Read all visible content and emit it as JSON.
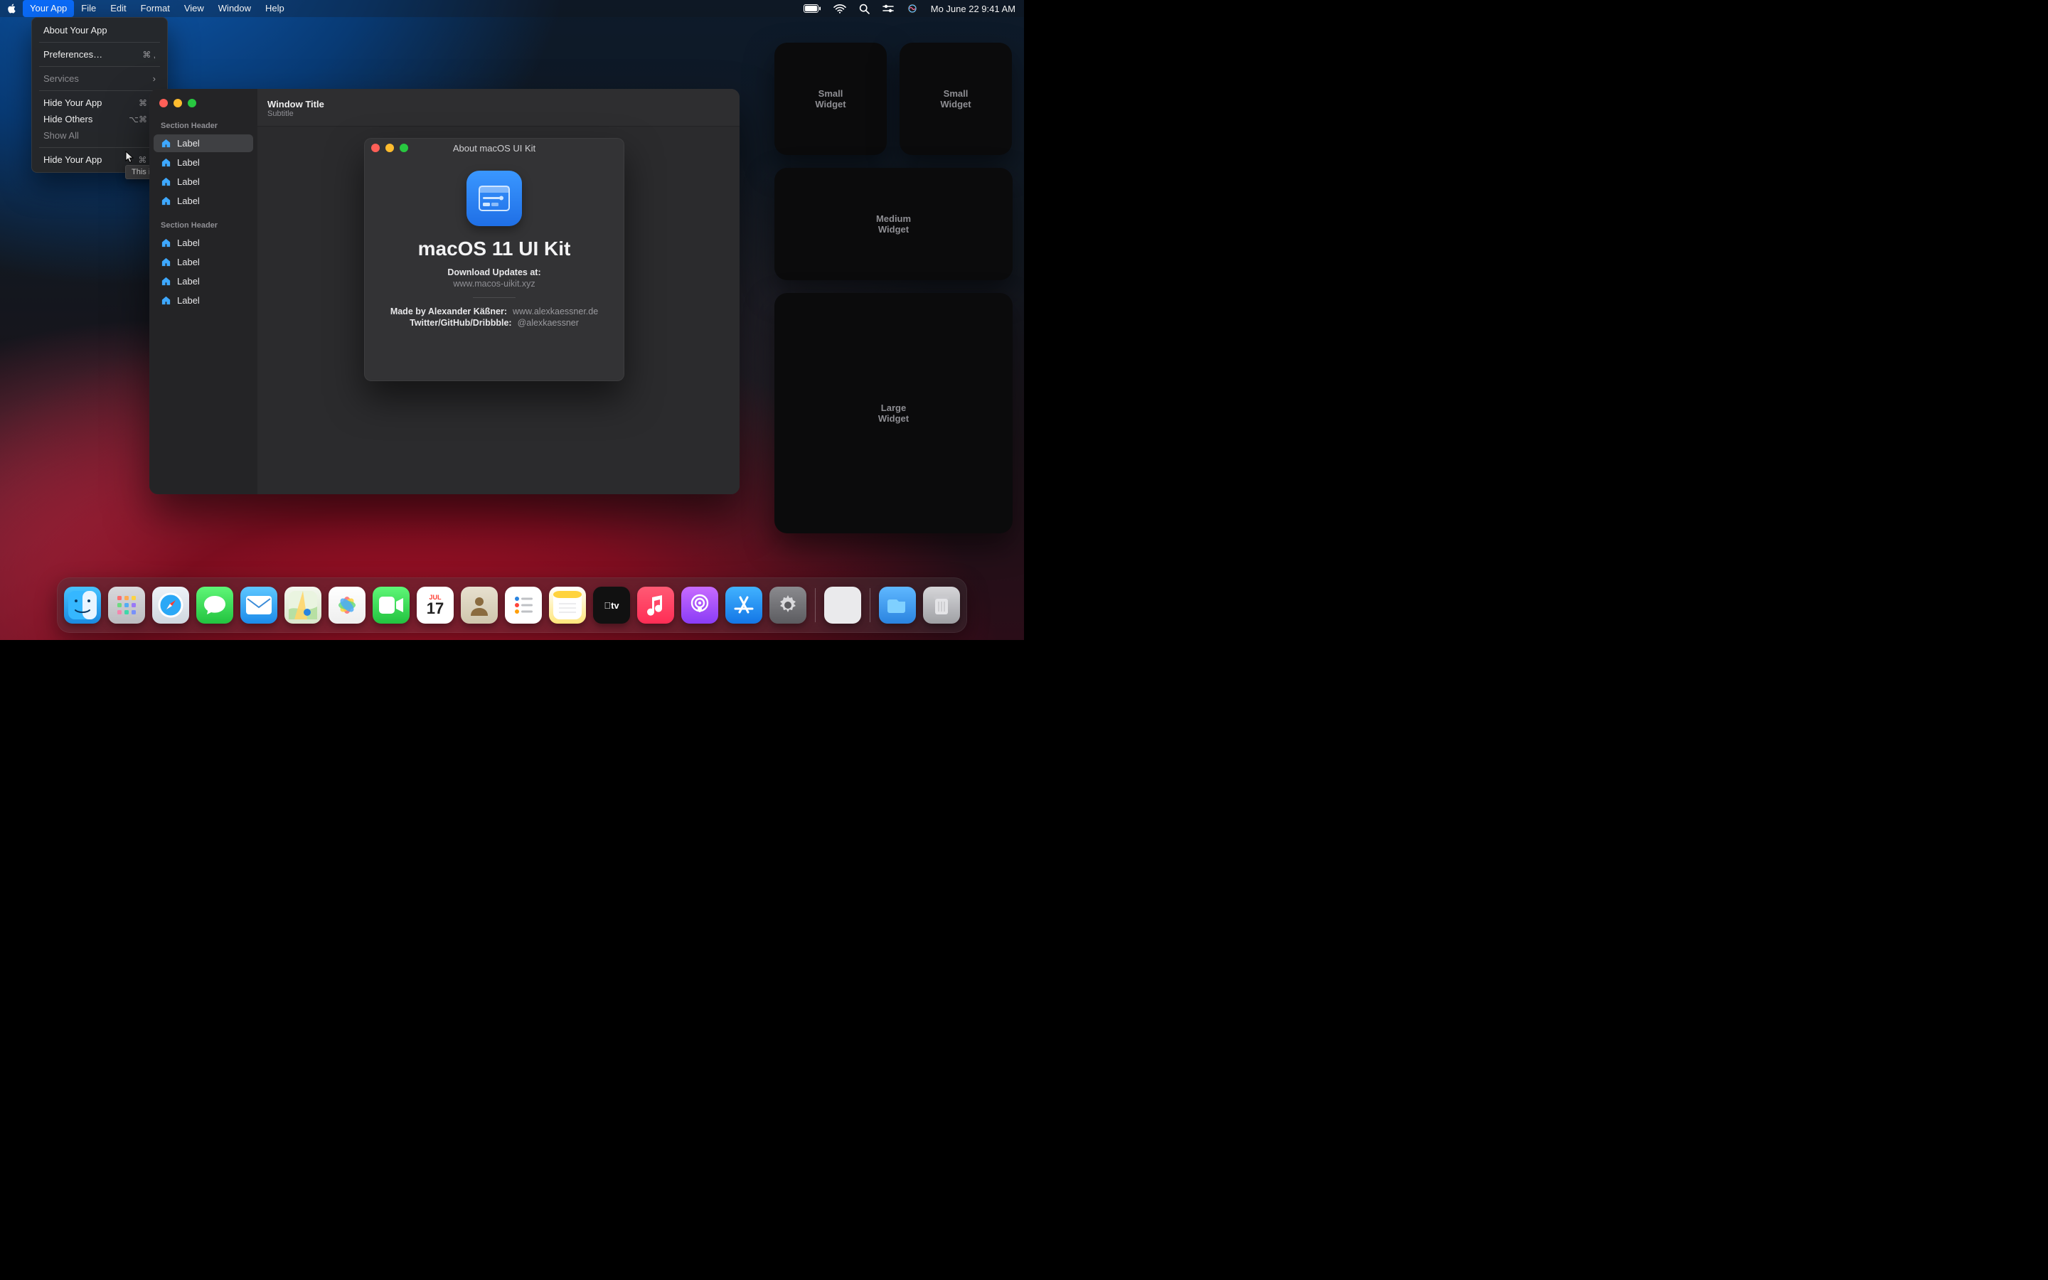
{
  "menubar": {
    "items": [
      "Your App",
      "File",
      "Edit",
      "Format",
      "View",
      "Window",
      "Help"
    ],
    "active_index": 0,
    "clock": "Mo June 22  9:41 AM"
  },
  "dropdown": {
    "about": "About Your App",
    "prefs": "Preferences…",
    "prefs_short": "⌘ ,",
    "services": "Services",
    "hide": "Hide Your App",
    "hide_short": "⌘ H",
    "hide_others": "Hide Others",
    "hide_others_short": "⌥⌘ H",
    "show_all": "Show All",
    "quit": "Hide Your App",
    "quit_short": "⌘ Q"
  },
  "tooltip": "This is a tooltip.",
  "window": {
    "title": "Window Title",
    "subtitle": "Subtitle",
    "section1": "Section Header",
    "section2": "Section Header",
    "items1": [
      "Label",
      "Label",
      "Label",
      "Label"
    ],
    "items2": [
      "Label",
      "Label",
      "Label",
      "Label"
    ]
  },
  "about": {
    "bar_title": "About macOS UI Kit",
    "title": "macOS 11 UI Kit",
    "dl_label": "Download Updates at:",
    "dl_url": "www.macos-uikit.xyz",
    "made_k": "Made by Alexander Käßner:",
    "made_v": "www.alexkaessner.de",
    "social_k": "Twitter/GitHub/Dribbble:",
    "social_v": "@alexkaessner"
  },
  "widgets": {
    "small": "Small\nWidget",
    "medium": "Medium\nWidget",
    "large": "Large\nWidget"
  },
  "calendar": {
    "month": "JUL",
    "day": "17"
  },
  "colors": {
    "accent": "#0a6af7"
  }
}
